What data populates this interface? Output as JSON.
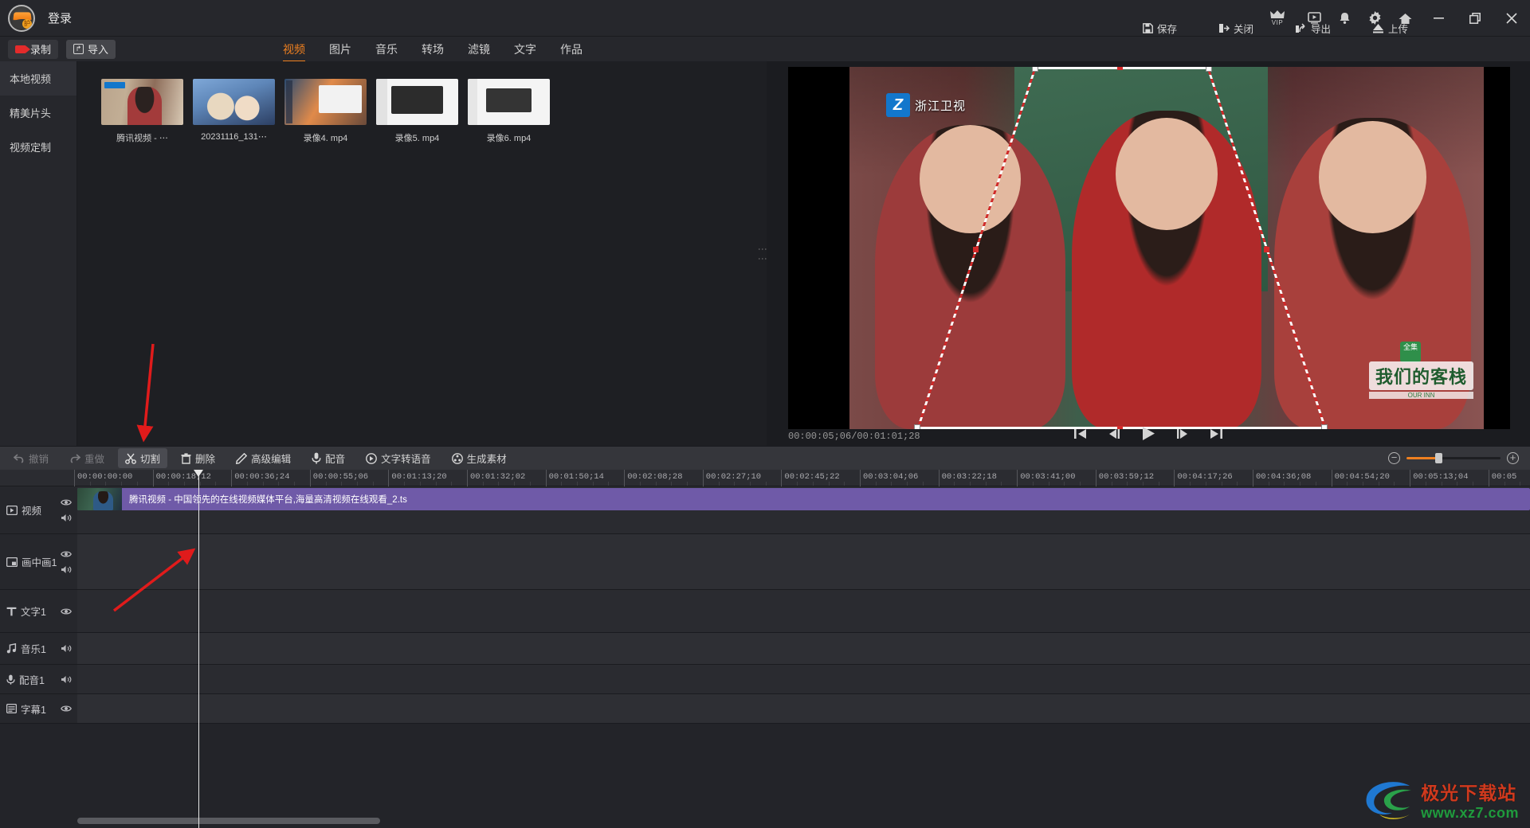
{
  "titlebar": {
    "login_label": "登录",
    "actions": [
      {
        "name": "save",
        "label": "保存",
        "icon": "save-icon"
      },
      {
        "name": "close-project",
        "label": "关闭",
        "icon": "exit-icon"
      },
      {
        "name": "export",
        "label": "导出",
        "icon": "export-icon"
      },
      {
        "name": "upload",
        "label": "上传",
        "icon": "upload-icon"
      }
    ],
    "icons": [
      {
        "name": "vip-crown-icon",
        "label": "VIP"
      },
      {
        "name": "video-tutorial-icon",
        "label": ""
      },
      {
        "name": "notification-bell-icon",
        "label": ""
      },
      {
        "name": "settings-gear-icon",
        "label": ""
      },
      {
        "name": "home-icon",
        "label": ""
      }
    ],
    "window_controls": [
      {
        "name": "minimize-button",
        "glyph": "—"
      },
      {
        "name": "maximize-button",
        "glyph": "❐"
      },
      {
        "name": "close-button",
        "glyph": "✕"
      }
    ]
  },
  "subbar": {
    "record_label": "录制",
    "import_label": "导入",
    "tabs": [
      {
        "label": "视频",
        "active": true
      },
      {
        "label": "图片",
        "active": false
      },
      {
        "label": "音乐",
        "active": false
      },
      {
        "label": "转场",
        "active": false
      },
      {
        "label": "滤镜",
        "active": false
      },
      {
        "label": "文字",
        "active": false
      },
      {
        "label": "作品",
        "active": false
      }
    ]
  },
  "sidebar": {
    "items": [
      {
        "label": "本地视频",
        "active": true
      },
      {
        "label": "精美片头",
        "active": false
      },
      {
        "label": "视频定制",
        "active": false
      }
    ]
  },
  "media": {
    "items": [
      {
        "label": "腾讯视频 - ⋯"
      },
      {
        "label": "20231116_131⋯"
      },
      {
        "label": "录像4. mp4"
      },
      {
        "label": "录像5. mp4"
      },
      {
        "label": "录像6. mp4"
      }
    ]
  },
  "preview": {
    "channel_logo": "浙江卫视",
    "channel_mark": "Z",
    "show_title": "我们的客栈",
    "show_sub": "OUR INN",
    "badge": "全集",
    "timecode": "00:00:05;06/00:01:01;28",
    "transport": [
      {
        "name": "jump-to-start-button"
      },
      {
        "name": "step-backward-button"
      },
      {
        "name": "play-button"
      },
      {
        "name": "step-forward-button"
      },
      {
        "name": "jump-to-end-button"
      }
    ]
  },
  "edit_toolbar": {
    "items": [
      {
        "label": "撤销",
        "icon": "undo-icon",
        "state": "disabled"
      },
      {
        "label": "重做",
        "icon": "redo-icon",
        "state": "disabled"
      },
      {
        "label": "切割",
        "icon": "scissors-icon",
        "state": "selected"
      },
      {
        "label": "删除",
        "icon": "trash-icon",
        "state": "normal"
      },
      {
        "label": "高级编辑",
        "icon": "pencil-icon",
        "state": "normal"
      },
      {
        "label": "配音",
        "icon": "microphone-icon",
        "state": "normal"
      },
      {
        "label": "文字转语音",
        "icon": "text-to-speech-icon",
        "state": "normal"
      },
      {
        "label": "生成素材",
        "icon": "film-reel-icon",
        "state": "normal"
      }
    ],
    "zoom_out_label": "−",
    "zoom_in_label": "+"
  },
  "timeline": {
    "ruler_labels": [
      "00:00:00:00",
      "00:00:18;12",
      "00:00:36;24",
      "00:00:55;06",
      "00:01:13;20",
      "00:01:32;02",
      "00:01:50;14",
      "00:02:08;28",
      "00:02:27;10",
      "00:02:45;22",
      "00:03:04;06",
      "00:03:22;18",
      "00:03:41;00",
      "00:03:59;12",
      "00:04:17;26",
      "00:04:36;08",
      "00:04:54;20",
      "00:05:13;04",
      "00:05"
    ],
    "tracks": [
      {
        "label": "视频",
        "icon": "video-track-icon",
        "eye": true,
        "speaker": true
      },
      {
        "label": "画中画1",
        "icon": "pip-track-icon",
        "eye": true,
        "speaker": true
      },
      {
        "label": "文字1",
        "icon": "text-track-icon",
        "eye": true,
        "speaker": false
      },
      {
        "label": "音乐1",
        "icon": "music-track-icon",
        "eye": false,
        "speaker": true
      },
      {
        "label": "配音1",
        "icon": "voiceover-track-icon",
        "eye": false,
        "speaker": true
      },
      {
        "label": "字幕1",
        "icon": "subtitle-track-icon",
        "eye": true,
        "speaker": false
      }
    ],
    "clip": {
      "title": "腾讯视频 - 中国领先的在线视频媒体平台,海量高清视频在线观看_2.ts",
      "color": "#6f5aa8"
    }
  },
  "watermark": {
    "line1": "极光下载站",
    "line2": "www.xz7.com"
  },
  "colors": {
    "accent": "#ef8020",
    "clip": "#6f5aa8",
    "annotation": "#e01b1b"
  }
}
